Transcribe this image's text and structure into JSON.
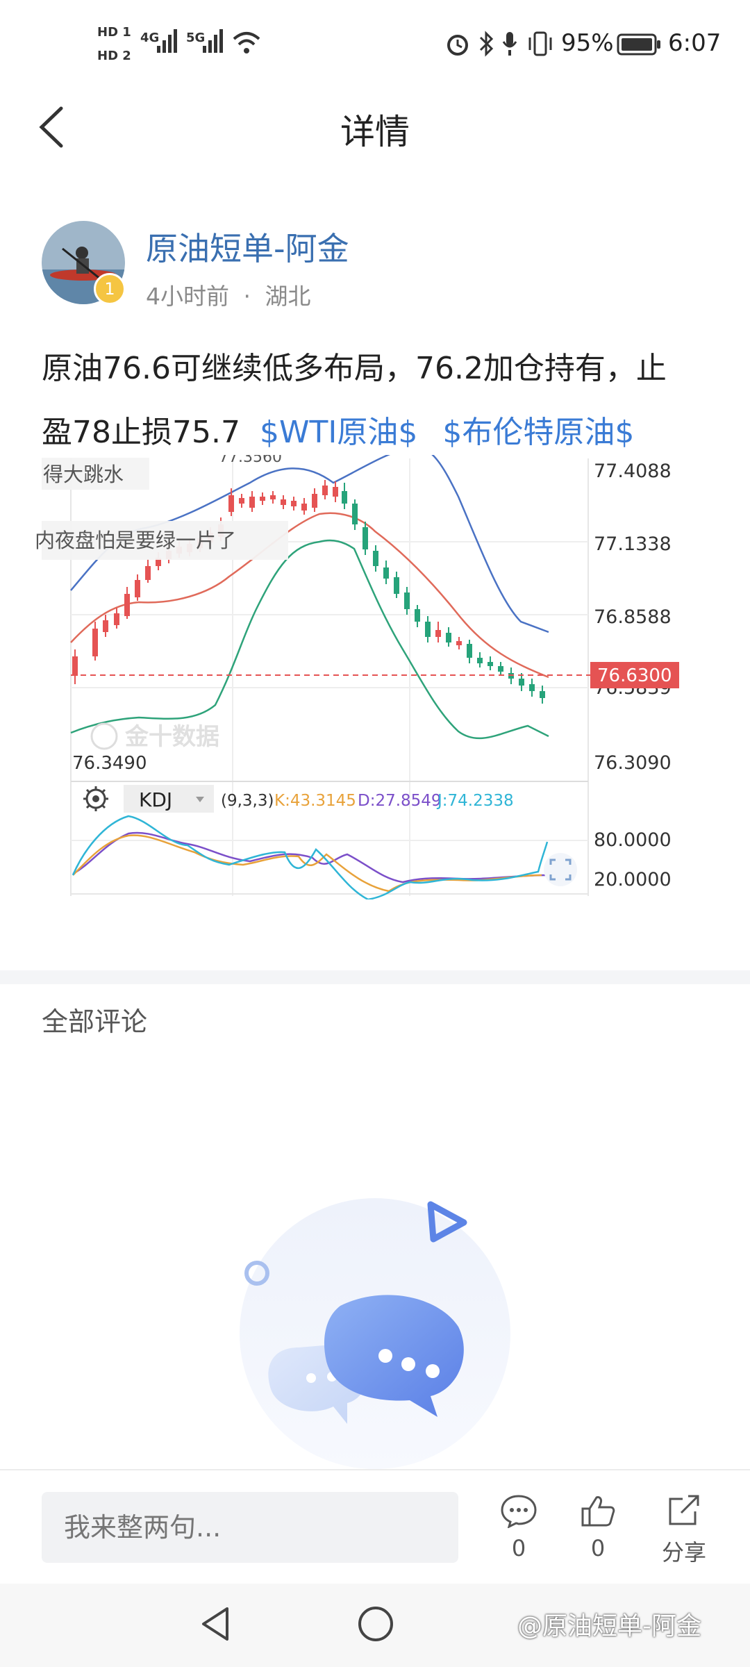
{
  "status_bar": {
    "hd1": "HD 1",
    "hd2": "HD 2",
    "net1": "4G",
    "net2": "5G",
    "battery": "95%",
    "time": "6:07"
  },
  "header": {
    "title": "详情"
  },
  "post": {
    "author": "原油短单-阿金",
    "badge": "1",
    "time_ago": "4小时前",
    "dot": "·",
    "location": "湖北",
    "text_line1": "原油76.6可继续低多布局，76.2加仓持有，止",
    "text_line2": "盈78止损75.7",
    "tag1": "$WTI原油$",
    "tag2": "$布伦特原油$"
  },
  "chart_data": {
    "type": "candlestick",
    "price_ticks": [
      "77.4088",
      "77.1338",
      "76.8588",
      "76.5839",
      "76.3090"
    ],
    "current_price": "76.6300",
    "low_label": "76.3490",
    "high_label_partial": "77.3560",
    "overlay_text1": "得大跳水",
    "overlay_text2": "内夜盘怕是要绿一片了",
    "watermark": "金十数据",
    "indicator": "KDJ",
    "indicator_params": "(9,3,3)",
    "k_value": "K:43.3145",
    "d_value": "D:27.8549",
    "j_value": "J:74.2338",
    "indicator_ticks": [
      "80.0000",
      "20.0000"
    ],
    "colors": {
      "up": "#e55353",
      "down": "#26a37a",
      "ma": "#e06a5a",
      "boll": "#2ea37a",
      "upper": "#4a72c4",
      "k": "#e8a23a",
      "d": "#7b4fc9",
      "j": "#2fb5d6"
    }
  },
  "comments": {
    "title": "全部评论"
  },
  "bottom_bar": {
    "input_placeholder": "我来整两句...",
    "comment_count": "0",
    "like_count": "0",
    "share_label": "分享"
  },
  "watermark": "@原油短单-阿金"
}
